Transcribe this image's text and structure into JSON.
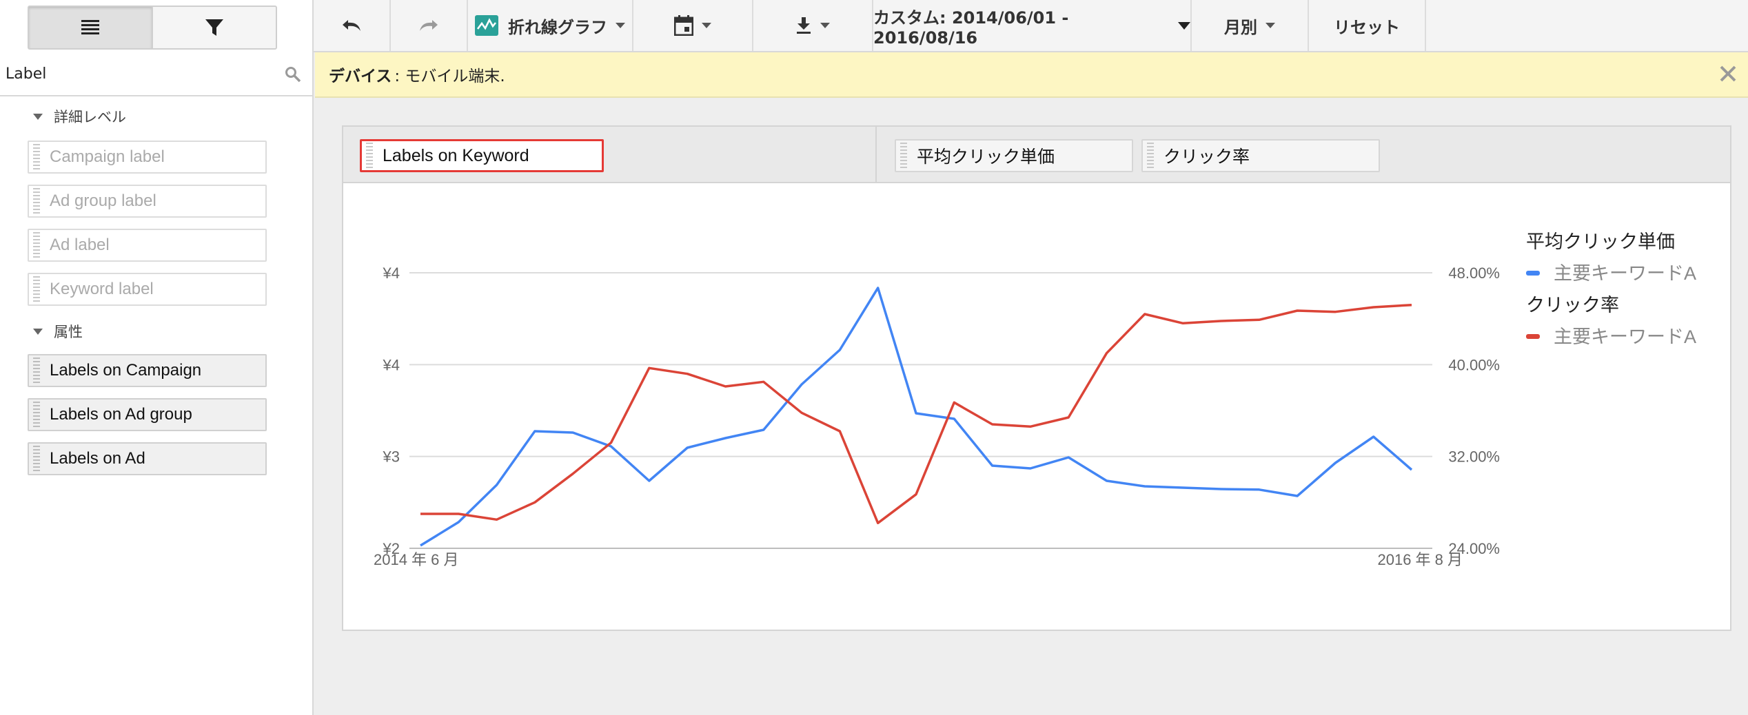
{
  "left_panel": {
    "search_value": "Label",
    "sections": {
      "detail": "詳細レベル",
      "attributes": "属性"
    },
    "detail_fields": [
      "Campaign label",
      "Ad group label",
      "Ad label",
      "Keyword label"
    ],
    "attribute_fields": [
      "Labels on Campaign",
      "Labels on Ad group",
      "Labels on Ad"
    ]
  },
  "toolbar": {
    "chart_type_label": "折れ線グラフ",
    "date_range_label": "カスタム: 2014/06/01 - 2016/08/16",
    "granularity_label": "月別",
    "reset_label": "リセット"
  },
  "notice": {
    "key": "デバイス",
    "value": ": モバイル端末."
  },
  "panel": {
    "dimension_chip": "Labels on Keyword",
    "metric_chips": [
      "平均クリック単価",
      "クリック率"
    ]
  },
  "colors": {
    "series_blue": "#4285f4",
    "series_red": "#db4437",
    "highlight": "#e53935"
  },
  "chart_data": {
    "type": "line",
    "x_start_label": "2014 年 6 月",
    "x_end_label": "2016 年 8 月",
    "left_axis_ticks": [
      "¥4",
      "¥4",
      "¥3",
      "¥2"
    ],
    "right_axis_ticks": [
      "48.00%",
      "40.00%",
      "32.00%",
      "24.00%"
    ],
    "right_ylim": [
      24,
      48
    ],
    "grid": true,
    "legend_position": "right",
    "legend": [
      {
        "title": "平均クリック単価",
        "entry": "主要キーワードA",
        "color": "#4285f4"
      },
      {
        "title": "クリック率",
        "entry": "主要キーワードA",
        "color": "#db4437"
      }
    ],
    "series": [
      {
        "name": "平均クリック単価 主要キーワードA",
        "axis": "left",
        "color": "#4285f4",
        "values_pct_of_range": [
          1.0,
          9.5,
          23.0,
          42.5,
          42.0,
          37.0,
          24.5,
          36.5,
          40.0,
          43.0,
          59.5,
          72.0,
          94.5,
          49.0,
          47.0,
          30.0,
          29.0,
          33.0,
          24.5,
          22.5,
          22.0,
          21.5,
          21.3,
          19.0,
          31.0,
          40.5,
          28.5
        ]
      },
      {
        "name": "クリック率 主要キーワードA",
        "axis": "right",
        "color": "#db4437",
        "values": [
          27.0,
          27.0,
          26.5,
          28.0,
          30.5,
          33.2,
          39.7,
          39.2,
          38.1,
          38.5,
          35.8,
          34.2,
          26.2,
          28.7,
          36.7,
          34.8,
          34.6,
          35.4,
          41.0,
          44.4,
          43.6,
          43.8,
          43.9,
          44.7,
          44.6,
          45.0,
          45.2
        ]
      }
    ]
  }
}
